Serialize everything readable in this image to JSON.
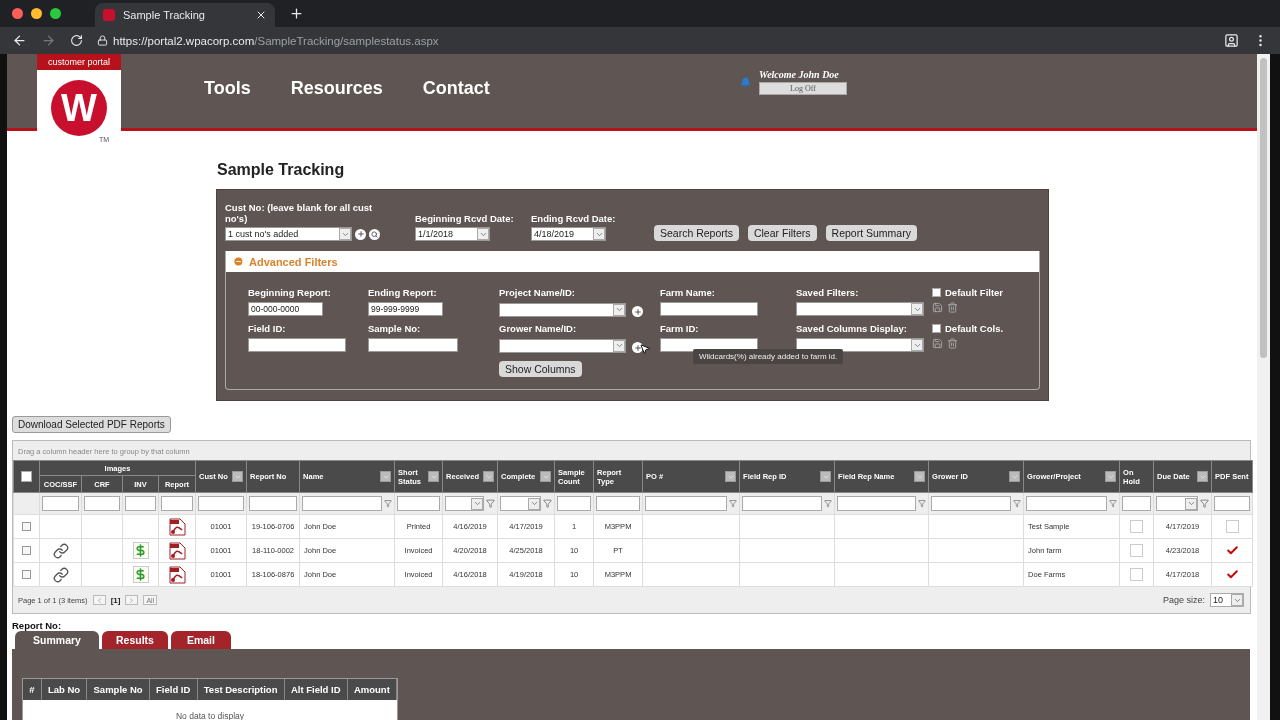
{
  "browser": {
    "tab_title": "Sample Tracking",
    "url_host": "https://portal2.wpacorp.com",
    "url_path": "/SampleTracking/samplestatus.aspx"
  },
  "header": {
    "logo": {
      "tagline": "customer portal",
      "mark": "W",
      "tm": "TM"
    },
    "nav": [
      "Tools",
      "Resources",
      "Contact"
    ],
    "welcome": "Welcome John Doe",
    "logoff": "Log Off"
  },
  "title": "Sample Tracking",
  "filters": {
    "cust_no": {
      "label": "Cust No: (leave blank for all cust no's)",
      "value": "1 cust no's added"
    },
    "begin_date": {
      "label": "Beginning Rcvd Date:",
      "value": "1/1/2018"
    },
    "end_date": {
      "label": "Ending Rcvd Date:",
      "value": "4/18/2019"
    },
    "buttons": [
      "Search Reports",
      "Clear Filters",
      "Report Summary"
    ],
    "advanced": {
      "title": "Advanced Filters",
      "expanded": true,
      "rows": [
        {
          "fields": [
            {
              "label": "Beginning Report:",
              "kind": "input",
              "value": "00-000-0000"
            },
            {
              "label": "Ending Report:",
              "kind": "input",
              "value": "99-999-9999"
            },
            {
              "label": "Project Name/ID:",
              "kind": "select_add"
            },
            {
              "label": "Farm Name:",
              "kind": "input"
            },
            {
              "label": "Saved Filters:",
              "kind": "select"
            }
          ],
          "option": {
            "label": "Default Filter",
            "checked": false
          }
        },
        {
          "fields": [
            {
              "label": "Field ID:",
              "kind": "input"
            },
            {
              "label": "Sample No:",
              "kind": "input"
            },
            {
              "label": "Grower Name/ID:",
              "kind": "select_add"
            },
            {
              "label": "Farm ID:",
              "kind": "input"
            },
            {
              "label": "Saved Columns Display:",
              "kind": "select"
            }
          ],
          "option": {
            "label": "Default Cols.",
            "checked": false
          }
        }
      ],
      "show_columns": "Show Columns",
      "tooltip": "Wildcards(%) already added to farm id."
    }
  },
  "download_button": "Download Selected PDF Reports",
  "grid": {
    "group_hint": "Drag a column header here to group by that column",
    "column_group": "Images",
    "columns": [
      {
        "kind": "select",
        "checked": false
      },
      {
        "label": "COC/SSF",
        "kind": "image",
        "menu": false,
        "funnel": false
      },
      {
        "label": "CRF",
        "kind": "image",
        "menu": false,
        "funnel": false
      },
      {
        "label": "INV",
        "kind": "image",
        "menu": false,
        "funnel": false
      },
      {
        "label": "Report",
        "kind": "image",
        "menu": false,
        "funnel": false
      },
      {
        "label": "Cust No",
        "kind": "text",
        "menu": true,
        "funnel": false
      },
      {
        "label": "Report No",
        "kind": "text",
        "menu": false,
        "funnel": false
      },
      {
        "label": "Name",
        "kind": "text",
        "menu": true,
        "funnel": true
      },
      {
        "label": "Short Status",
        "kind": "text",
        "menu": true,
        "funnel": false
      },
      {
        "label": "Received",
        "kind": "date",
        "menu": true,
        "funnel": true
      },
      {
        "label": "Complete",
        "kind": "date",
        "menu": true,
        "funnel": true
      },
      {
        "label": "Sample Count",
        "kind": "text",
        "menu": false,
        "funnel": false
      },
      {
        "label": "Report Type",
        "kind": "text",
        "menu": false,
        "funnel": false
      },
      {
        "label": "PO #",
        "kind": "text",
        "menu": true,
        "funnel": true
      },
      {
        "label": "Field Rep ID",
        "kind": "text",
        "menu": true,
        "funnel": true
      },
      {
        "label": "Field Rep Name",
        "kind": "text",
        "menu": true,
        "funnel": true
      },
      {
        "label": "Grower ID",
        "kind": "text",
        "menu": true,
        "funnel": true
      },
      {
        "label": "Grower/Project",
        "kind": "text",
        "menu": true,
        "funnel": true
      },
      {
        "label": "On Hold",
        "kind": "check",
        "menu": false,
        "funnel": false
      },
      {
        "label": "Due Date",
        "kind": "date",
        "menu": true,
        "funnel": true
      },
      {
        "label": "PDF Sent",
        "kind": "sent",
        "menu": false,
        "funnel": false
      }
    ],
    "rows": [
      {
        "selected": false,
        "coc_ssf": false,
        "inv": false,
        "report": true,
        "cust_no": "01001",
        "report_no": "19-106-0706",
        "name": "John Doe",
        "short_status": "Printed",
        "received": "4/16/2019",
        "complete": "4/17/2019",
        "sample_count": "1",
        "report_type": "M3PPM",
        "grower_project": "Test Sample",
        "on_hold": false,
        "due_date": "4/17/2019",
        "pdf_sent": false
      },
      {
        "selected": false,
        "coc_ssf": true,
        "inv": true,
        "report": true,
        "cust_no": "01001",
        "report_no": "18-110-0002",
        "name": "John Doe",
        "short_status": "Invoiced",
        "received": "4/20/2018",
        "complete": "4/25/2018",
        "sample_count": "10",
        "report_type": "PT",
        "grower_project": "John farm",
        "on_hold": false,
        "due_date": "4/23/2018",
        "pdf_sent": true
      },
      {
        "selected": false,
        "coc_ssf": true,
        "inv": true,
        "report": true,
        "cust_no": "01001",
        "report_no": "18-106-0876",
        "name": "John Doe",
        "short_status": "Invoiced",
        "received": "4/16/2018",
        "complete": "4/19/2018",
        "sample_count": "10",
        "report_type": "M3PPM",
        "grower_project": "Doe Farms",
        "on_hold": false,
        "due_date": "4/17/2018",
        "pdf_sent": true
      }
    ],
    "pager": {
      "summary": "Page 1 of 1 (3 items)",
      "current": "[1]",
      "all": "All",
      "size_label": "Page size:",
      "size": "10"
    }
  },
  "details": {
    "label": "Report No:",
    "tabs": [
      {
        "label": "Summary",
        "selected": true
      },
      {
        "label": "Results",
        "selected": false
      },
      {
        "label": "Email",
        "selected": false
      }
    ],
    "columns": [
      "#",
      "Lab No",
      "Sample No",
      "Field ID",
      "Test Description",
      "Alt Field ID",
      "Amount"
    ],
    "empty_text": "No data to display"
  }
}
